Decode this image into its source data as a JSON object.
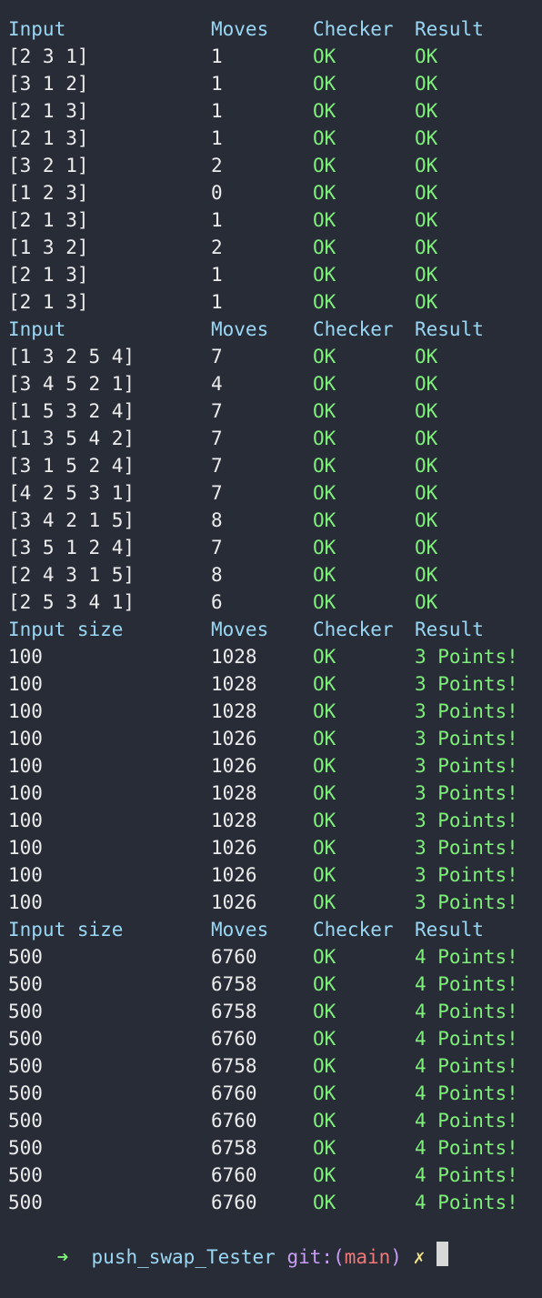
{
  "sections": [
    {
      "header": [
        "Input",
        "Moves",
        "Checker",
        "Result"
      ],
      "rows": [
        [
          "[2 3 1]",
          "1",
          "OK",
          "OK"
        ],
        [
          "[3 1 2]",
          "1",
          "OK",
          "OK"
        ],
        [
          "[2 1 3]",
          "1",
          "OK",
          "OK"
        ],
        [
          "[2 1 3]",
          "1",
          "OK",
          "OK"
        ],
        [
          "[3 2 1]",
          "2",
          "OK",
          "OK"
        ],
        [
          "[1 2 3]",
          "0",
          "OK",
          "OK"
        ],
        [
          "[2 1 3]",
          "1",
          "OK",
          "OK"
        ],
        [
          "[1 3 2]",
          "2",
          "OK",
          "OK"
        ],
        [
          "[2 1 3]",
          "1",
          "OK",
          "OK"
        ],
        [
          "[2 1 3]",
          "1",
          "OK",
          "OK"
        ]
      ]
    },
    {
      "header": [
        "Input",
        "Moves",
        "Checker",
        "Result"
      ],
      "rows": [
        [
          "[1 3 2 5 4]",
          "7",
          "OK",
          "OK"
        ],
        [
          "[3 4 5 2 1]",
          "4",
          "OK",
          "OK"
        ],
        [
          "[1 5 3 2 4]",
          "7",
          "OK",
          "OK"
        ],
        [
          "[1 3 5 4 2]",
          "7",
          "OK",
          "OK"
        ],
        [
          "[3 1 5 2 4]",
          "7",
          "OK",
          "OK"
        ],
        [
          "[4 2 5 3 1]",
          "7",
          "OK",
          "OK"
        ],
        [
          "[3 4 2 1 5]",
          "8",
          "OK",
          "OK"
        ],
        [
          "[3 5 1 2 4]",
          "7",
          "OK",
          "OK"
        ],
        [
          "[2 4 3 1 5]",
          "8",
          "OK",
          "OK"
        ],
        [
          "[2 5 3 4 1]",
          "6",
          "OK",
          "OK"
        ]
      ]
    },
    {
      "header": [
        "Input size",
        "Moves",
        "Checker",
        "Result"
      ],
      "rows": [
        [
          "100",
          "1028",
          "OK",
          "3 Points!"
        ],
        [
          "100",
          "1028",
          "OK",
          "3 Points!"
        ],
        [
          "100",
          "1028",
          "OK",
          "3 Points!"
        ],
        [
          "100",
          "1026",
          "OK",
          "3 Points!"
        ],
        [
          "100",
          "1026",
          "OK",
          "3 Points!"
        ],
        [
          "100",
          "1028",
          "OK",
          "3 Points!"
        ],
        [
          "100",
          "1028",
          "OK",
          "3 Points!"
        ],
        [
          "100",
          "1026",
          "OK",
          "3 Points!"
        ],
        [
          "100",
          "1026",
          "OK",
          "3 Points!"
        ],
        [
          "100",
          "1026",
          "OK",
          "3 Points!"
        ]
      ]
    },
    {
      "header": [
        "Input size",
        "Moves",
        "Checker",
        "Result"
      ],
      "rows": [
        [
          "500",
          "6760",
          "OK",
          "4 Points!"
        ],
        [
          "500",
          "6758",
          "OK",
          "4 Points!"
        ],
        [
          "500",
          "6758",
          "OK",
          "4 Points!"
        ],
        [
          "500",
          "6760",
          "OK",
          "4 Points!"
        ],
        [
          "500",
          "6758",
          "OK",
          "4 Points!"
        ],
        [
          "500",
          "6760",
          "OK",
          "4 Points!"
        ],
        [
          "500",
          "6760",
          "OK",
          "4 Points!"
        ],
        [
          "500",
          "6758",
          "OK",
          "4 Points!"
        ],
        [
          "500",
          "6760",
          "OK",
          "4 Points!"
        ],
        [
          "500",
          "6760",
          "OK",
          "4 Points!"
        ]
      ]
    }
  ],
  "prompt": {
    "arrow": "➜",
    "directory": "push_swap_Tester",
    "git_label": "git:",
    "open_paren": "(",
    "branch": "main",
    "close_paren": ")",
    "dirty_marker": "✗"
  },
  "colors": {
    "background": "#282c36",
    "header": "#9ad7f5",
    "ok": "#7ef07a",
    "text": "#ececec",
    "git": "#c79df5",
    "branch": "#f07878",
    "dirty": "#f2e28a"
  }
}
